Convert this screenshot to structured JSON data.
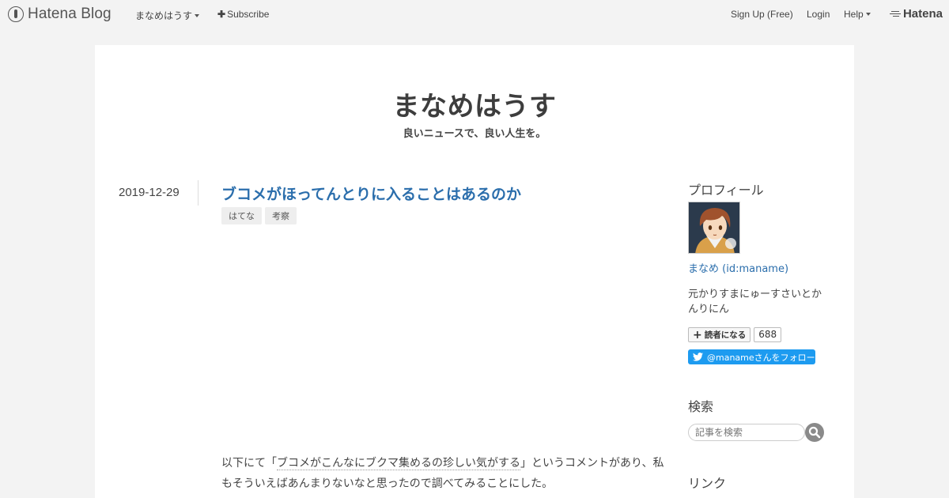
{
  "global_header": {
    "logo_text": "Hatena Blog",
    "blog_menu": "まなめはうす",
    "subscribe": "Subscribe",
    "signup": "Sign Up (Free)",
    "login": "Login",
    "help": "Help",
    "hatena_logo": "Hatena"
  },
  "blog": {
    "title": "まなめはうす",
    "description": "良いニュースで、良い人生を。"
  },
  "entry": {
    "date": "2019-12-29",
    "title": "ブコメがほってんとりに入ることはあるのか",
    "tags": [
      "はてな",
      "考察"
    ],
    "body_pre": "以下にて「",
    "body_quote": "ブコメがこんなにブクマ集めるの珍しい気がする",
    "body_post": "」というコメントがあり、私もそういえばあんまりないなと思ったので調べてみることにした。"
  },
  "sidebar": {
    "profile_heading": "プロフィール",
    "profile_name": "まなめ (id:maname)",
    "profile_desc": "元かりすまにゅーすさいとかんりにん",
    "subscribe_label": "読者になる",
    "subscriber_count": "688",
    "twitter_follow": "@manameさんをフォロー",
    "search_heading": "検索",
    "search_placeholder": "記事を検索",
    "links_heading": "リンク"
  },
  "colors": {
    "link": "#2b6eac",
    "twitter": "#1d9bf0",
    "background": "#f3f3f3"
  }
}
